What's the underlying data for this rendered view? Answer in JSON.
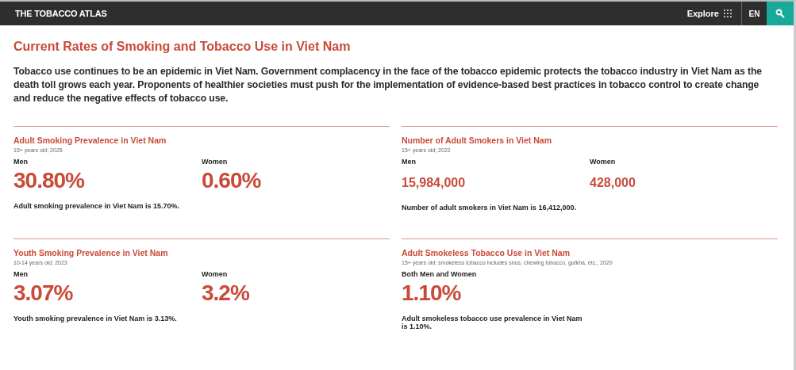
{
  "header": {
    "logo": "THE TOBACCO ATLAS",
    "explore": "Explore",
    "language": "EN"
  },
  "title": "Current Rates of Smoking and Tobacco Use in Viet Nam",
  "intro": "Tobacco use continues to be an epidemic in Viet Nam. Government complacency in the face of the tobacco epidemic protects the tobacco industry in Viet Nam as the death toll grows each year. Proponents of healthier societies must push for the implementation of evidence-based best practices in tobacco control to create change and reduce the negative effects of tobacco use.",
  "cards": [
    {
      "kind": "percent",
      "title": "Adult Smoking Prevalence in Viet Nam",
      "subtitle": "15+ years old; 2025",
      "stats": [
        {
          "label": "Men",
          "value": "30.80%"
        },
        {
          "label": "Women",
          "value": "0.60%"
        }
      ],
      "note": "Adult smoking prevalence in Viet Nam is 15.70%."
    },
    {
      "kind": "count",
      "title": "Number of Adult Smokers in Viet Nam",
      "subtitle": "15+ years old; 2022",
      "stats": [
        {
          "label": "Men",
          "value": "15,984,000"
        },
        {
          "label": "Women",
          "value": "428,000"
        }
      ],
      "note": "Number of adult smokers in Viet Nam is 16,412,000."
    },
    {
      "kind": "percent",
      "title": "Youth Smoking Prevalence in Viet Nam",
      "subtitle": "10-14 years old; 2023",
      "stats": [
        {
          "label": "Men",
          "value": "3.07%"
        },
        {
          "label": "Women",
          "value": "3.2%"
        }
      ],
      "note": "Youth smoking prevalence in Viet Nam is 3.13%."
    },
    {
      "kind": "percent",
      "title": "Adult Smokeless Tobacco Use in Viet Nam",
      "subtitle": "15+ years old; smokeless tobacco includes snus, chewing tobacco, gutkha, etc.; 2020",
      "stats": [
        {
          "label": "Both Men and Women",
          "value": "1.10%"
        }
      ],
      "note": "Adult smokeless tobacco use prevalence in Viet Nam is 1.10%."
    }
  ]
}
